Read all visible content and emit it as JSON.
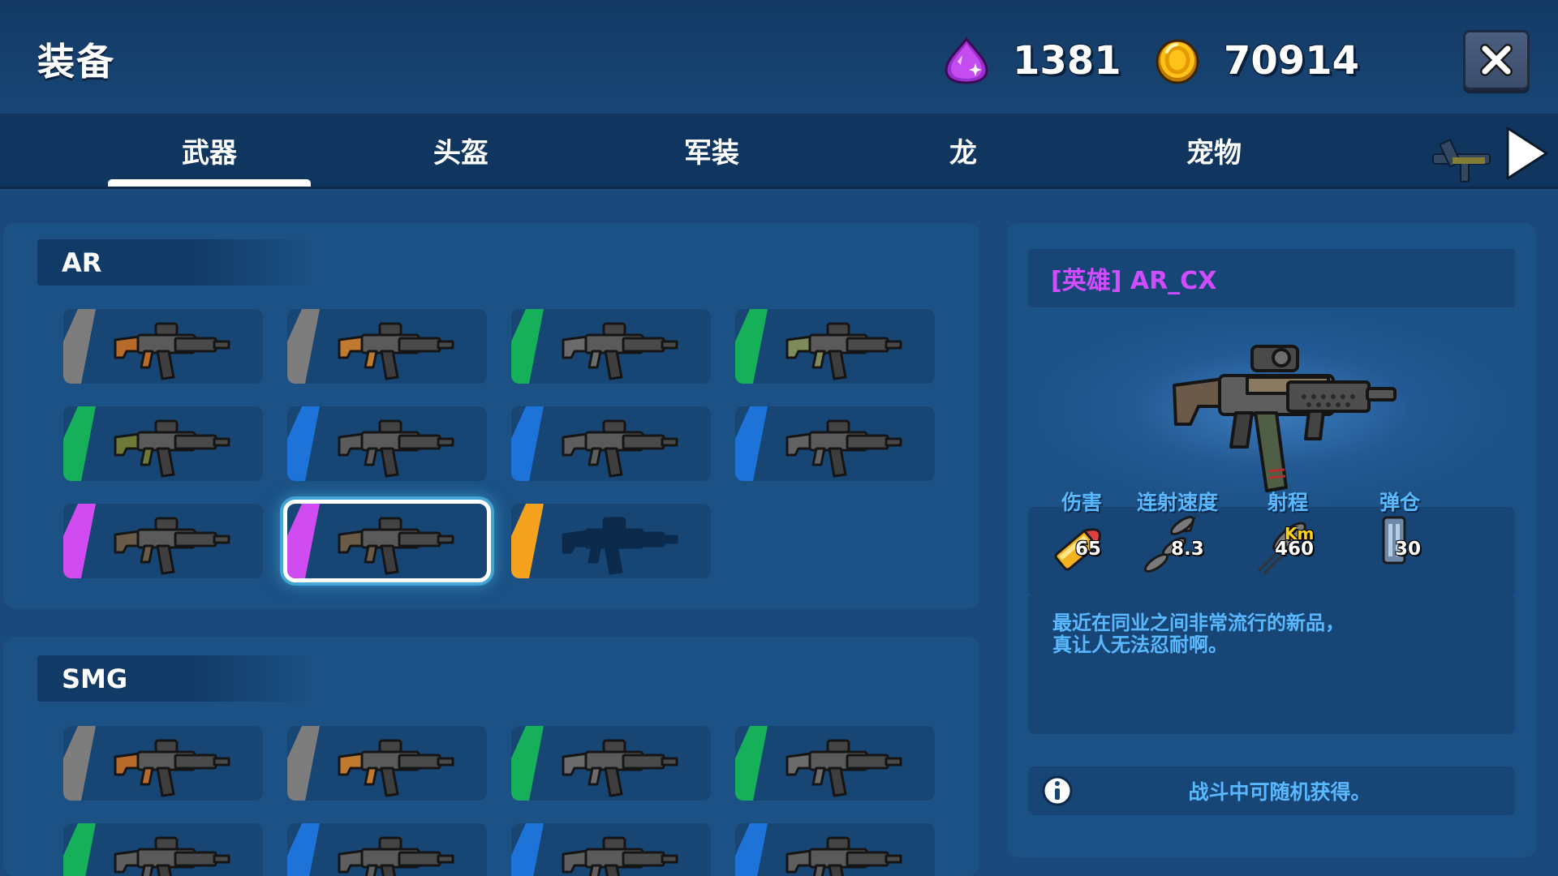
{
  "header": {
    "title": "装备",
    "gems": "1381",
    "coins": "70914",
    "close_icon": "close-x-icon"
  },
  "tabs": [
    {
      "label": "武器",
      "active": true
    },
    {
      "label": "头盔",
      "active": false
    },
    {
      "label": "军装",
      "active": false
    },
    {
      "label": "龙",
      "active": false
    },
    {
      "label": "宠物",
      "active": false
    }
  ],
  "colors": {
    "common": "#7d7d7d",
    "uncommon": "#16b05a",
    "rare": "#1e73d8",
    "epic": "#d04cf0",
    "legendary": "#f5a21e",
    "title_purple": "#d04cff",
    "stat_blue": "#5ab8ff"
  },
  "categories": [
    {
      "name": "AR",
      "weapons": [
        {
          "rarity": "common",
          "tint": "#b86a2a"
        },
        {
          "rarity": "common",
          "tint": "#c07a30"
        },
        {
          "rarity": "uncommon",
          "tint": "#6b6b6b"
        },
        {
          "rarity": "uncommon",
          "tint": "#7d8a5a"
        },
        {
          "rarity": "uncommon",
          "tint": "#6f7a3a"
        },
        {
          "rarity": "rare",
          "tint": "#5a5a5a"
        },
        {
          "rarity": "rare",
          "tint": "#5e5e5e"
        },
        {
          "rarity": "rare",
          "tint": "#626262"
        },
        {
          "rarity": "epic",
          "tint": "#6a5a48"
        },
        {
          "rarity": "epic",
          "tint": "#6a5a48",
          "selected": true
        },
        {
          "rarity": "legendary",
          "tint": "#0c2a4c",
          "locked": true
        }
      ]
    },
    {
      "name": "SMG",
      "weapons": [
        {
          "rarity": "common",
          "tint": "#b86a2a"
        },
        {
          "rarity": "common",
          "tint": "#c07a30"
        },
        {
          "rarity": "uncommon",
          "tint": "#6b6b6b"
        },
        {
          "rarity": "uncommon",
          "tint": "#6b6b6b"
        },
        {
          "rarity": "uncommon",
          "tint": "#5e5e5e"
        },
        {
          "rarity": "rare",
          "tint": "#5e5e5e"
        },
        {
          "rarity": "rare",
          "tint": "#5e5e5e"
        },
        {
          "rarity": "rare",
          "tint": "#5e5e5e"
        }
      ]
    }
  ],
  "detail": {
    "title": "[英雄] AR_CX",
    "stats": [
      {
        "label": "伤害",
        "value": "65",
        "icon": "bullet-icon"
      },
      {
        "label": "连射速度",
        "value": "8.3",
        "icon": "fire-rate-icon"
      },
      {
        "label": "射程",
        "value": "460",
        "icon": "range-icon",
        "unit": "Km"
      },
      {
        "label": "弹仓",
        "value": "30",
        "icon": "magazine-icon"
      }
    ],
    "description": [
      "最近在同业之间非常流行的新品，",
      "真让人无法忍耐啊。"
    ],
    "source": "战斗中可随机获得。"
  }
}
